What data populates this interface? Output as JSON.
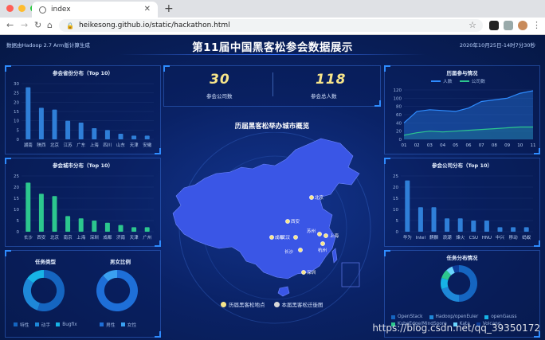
{
  "browser": {
    "tab_title": "index",
    "url": "heikesong.github.io/static/hackathon.html",
    "dot_colors": [
      "#ff5f57",
      "#febc2e",
      "#28c840"
    ]
  },
  "header": {
    "left": "数据由Hadoop 2.7 Arm版计算生成",
    "title": "第11届中国黑客松参会数据展示",
    "right": "2020年10月25日-14时7分30秒"
  },
  "stats": {
    "companies_value": "30",
    "companies_label": "参会公司数",
    "people_value": "118",
    "people_label": "参会总人数"
  },
  "map": {
    "title": "历届黑客松举办城市概览",
    "legend_hosts": "历届黑客松地点",
    "legend_migration": "本届黑客松迁徙图",
    "cities": [
      "北京",
      "西安",
      "成都",
      "武汉",
      "苏州",
      "上海",
      "长沙",
      "杭州",
      "深圳"
    ]
  },
  "charts": {
    "province": {
      "chart_data": {
        "type": "bar",
        "title": "参会省份分布（Top 10）",
        "categories": [
          "湖南",
          "陕西",
          "北京",
          "江苏",
          "广东",
          "上海",
          "四川",
          "山东",
          "天津",
          "安徽"
        ],
        "values": [
          28,
          17,
          16,
          10,
          9,
          6,
          5,
          3,
          2,
          2
        ],
        "ylim": [
          0,
          30
        ],
        "yticks": [
          "0",
          "5",
          "10",
          "15",
          "20",
          "25",
          "30"
        ],
        "color": "#2f7fd8"
      }
    },
    "city": {
      "chart_data": {
        "type": "bar",
        "title": "参会城市分布（Top 10）",
        "categories": [
          "长沙",
          "西安",
          "北京",
          "南京",
          "上海",
          "深圳",
          "成都",
          "济南",
          "天津",
          "广州"
        ],
        "values": [
          22,
          17,
          16,
          7,
          6,
          5,
          4,
          3,
          2,
          2
        ],
        "ylim": [
          0,
          25
        ],
        "yticks": [
          "0",
          "5",
          "10",
          "15",
          "20",
          "25"
        ],
        "color": "#2cc78e"
      }
    },
    "history": {
      "chart_data": {
        "type": "line",
        "title": "历届参与情况",
        "x": [
          "01",
          "02",
          "03",
          "04",
          "05",
          "06",
          "07",
          "08",
          "09",
          "10",
          "11"
        ],
        "series": [
          {
            "name": "人数",
            "values": [
              40,
              68,
              72,
              70,
              68,
              76,
              92,
              96,
              100,
              112,
              118
            ]
          },
          {
            "name": "公司数",
            "values": [
              10,
              16,
              20,
              18,
              20,
              22,
              24,
              26,
              28,
              30,
              30
            ]
          }
        ],
        "ylim": [
          0,
          120
        ],
        "yticks": [
          "0",
          "20",
          "40",
          "60",
          "80",
          "100",
          "120"
        ],
        "colors": [
          "#2e8cff",
          "#2cc78e"
        ]
      }
    },
    "company": {
      "chart_data": {
        "type": "bar",
        "title": "参会公司分布（Top 10）",
        "categories": [
          "华为",
          "Intel",
          "麒麟",
          "浪潮",
          "烽火",
          "CSU",
          "HNU",
          "中兴",
          "移动",
          "蚂蚁"
        ],
        "values": [
          23,
          11,
          11,
          6,
          6,
          5,
          5,
          2,
          2,
          2
        ],
        "ylim": [
          0,
          25
        ],
        "yticks": [
          "0",
          "5",
          "10",
          "15",
          "20",
          "25"
        ],
        "color": "#2f7fd8"
      }
    },
    "task_type": {
      "chart_data": {
        "type": "pie",
        "title": "任务类型",
        "categories": [
          "特性",
          "动手",
          "Bugfix"
        ],
        "values": [
          55,
          30,
          15
        ],
        "colors": [
          "#1565c0",
          "#1e88d8",
          "#17b3e6"
        ]
      }
    },
    "gender": {
      "chart_data": {
        "type": "pie",
        "title": "男女比例",
        "categories": [
          "男性",
          "女性"
        ],
        "values": [
          88,
          12
        ],
        "colors": [
          "#1e6fd8",
          "#3aa0f0"
        ]
      }
    },
    "task_dist": {
      "chart_data": {
        "type": "pie",
        "title": "任务分布情况",
        "categories": [
          "OpenStack",
          "Hadoop/openEuler",
          "openGauss",
          "KubeEdge/MindSpore",
          "Kata",
          "Volcano"
        ],
        "values": [
          50,
          20,
          10,
          8,
          6,
          6
        ],
        "colors": [
          "#1565c0",
          "#1e88d8",
          "#17b3e6",
          "#2cc78e",
          "#6ad6ff",
          "#0d3d9a"
        ]
      }
    }
  },
  "watermark": "https://blog.csdn.net/qq_39350172"
}
